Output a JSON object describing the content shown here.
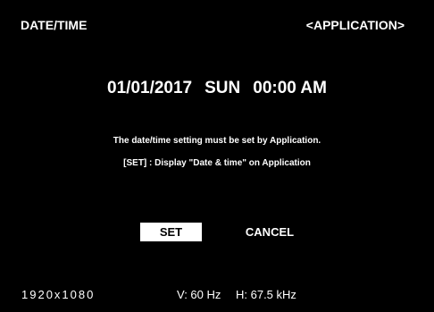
{
  "header": {
    "title": "DATE/TIME",
    "mode": "<APPLICATION>"
  },
  "datetime": {
    "date": "01/01/2017",
    "day": "SUN",
    "time": "00:00 AM"
  },
  "message": {
    "line1": "The date/time setting must be set by Application.",
    "line2": "[SET] : Display \"Date & time\" on Application"
  },
  "buttons": {
    "set_label": "SET",
    "cancel_label": "CANCEL"
  },
  "footer": {
    "resolution": "1920x1080",
    "v_freq": "V: 60 Hz",
    "h_freq": "H: 67.5 kHz"
  },
  "colors": {
    "background": "#000000",
    "text": "#ffffff",
    "selected_button_bg": "#ffffff",
    "selected_button_text": "#000000"
  }
}
